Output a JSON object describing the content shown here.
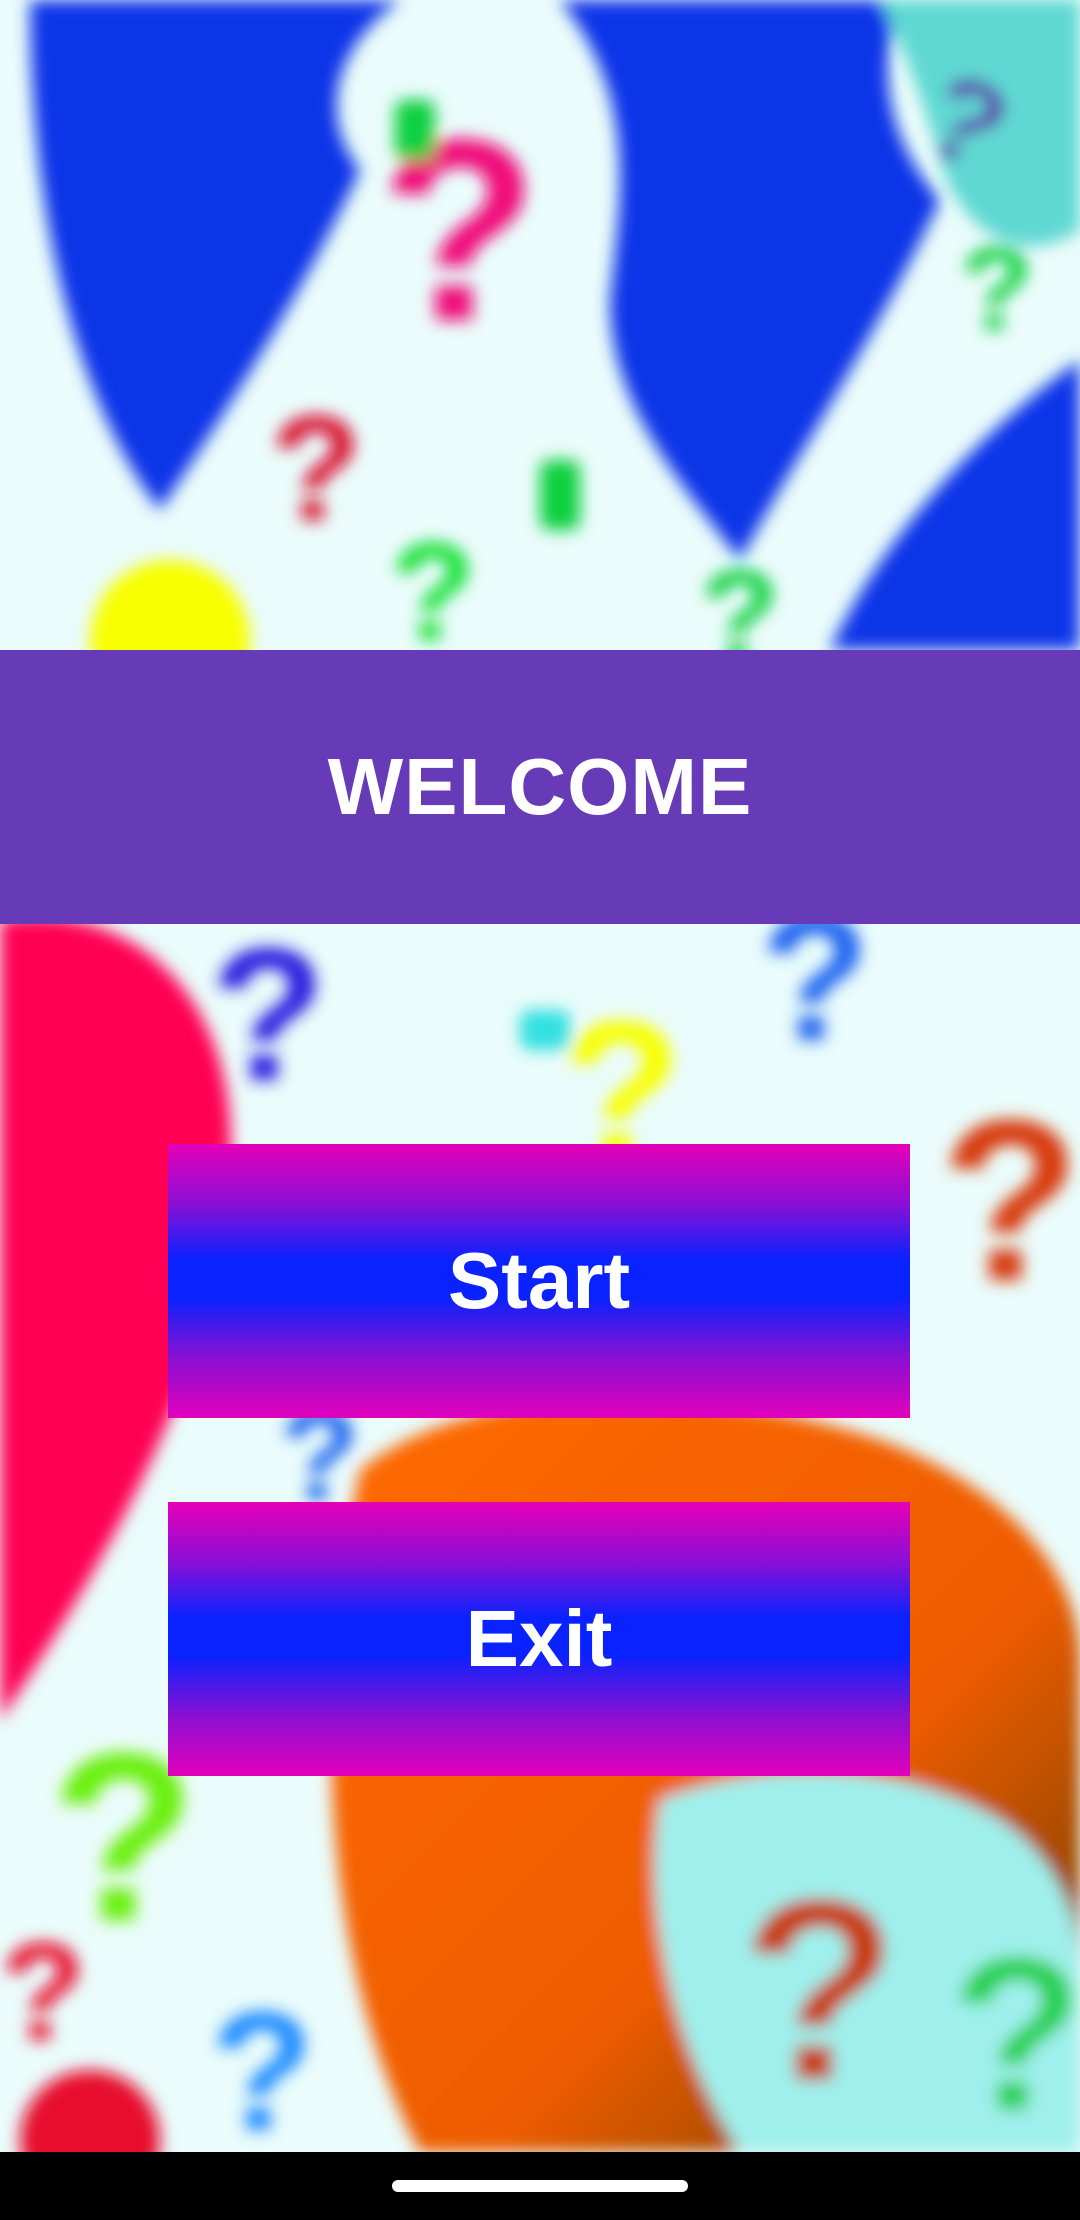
{
  "banner": {
    "title": "WELCOME"
  },
  "buttons": {
    "start_label": "Start",
    "exit_label": "Exit"
  },
  "icons": {
    "background": "question-marks-pattern",
    "nav": "home-indicator"
  },
  "colors": {
    "banner": "#673ab7",
    "button_gradient_edge": "#e600b8",
    "button_gradient_center": "#0a22ff",
    "text": "#ffffff",
    "navbar": "#000000"
  }
}
